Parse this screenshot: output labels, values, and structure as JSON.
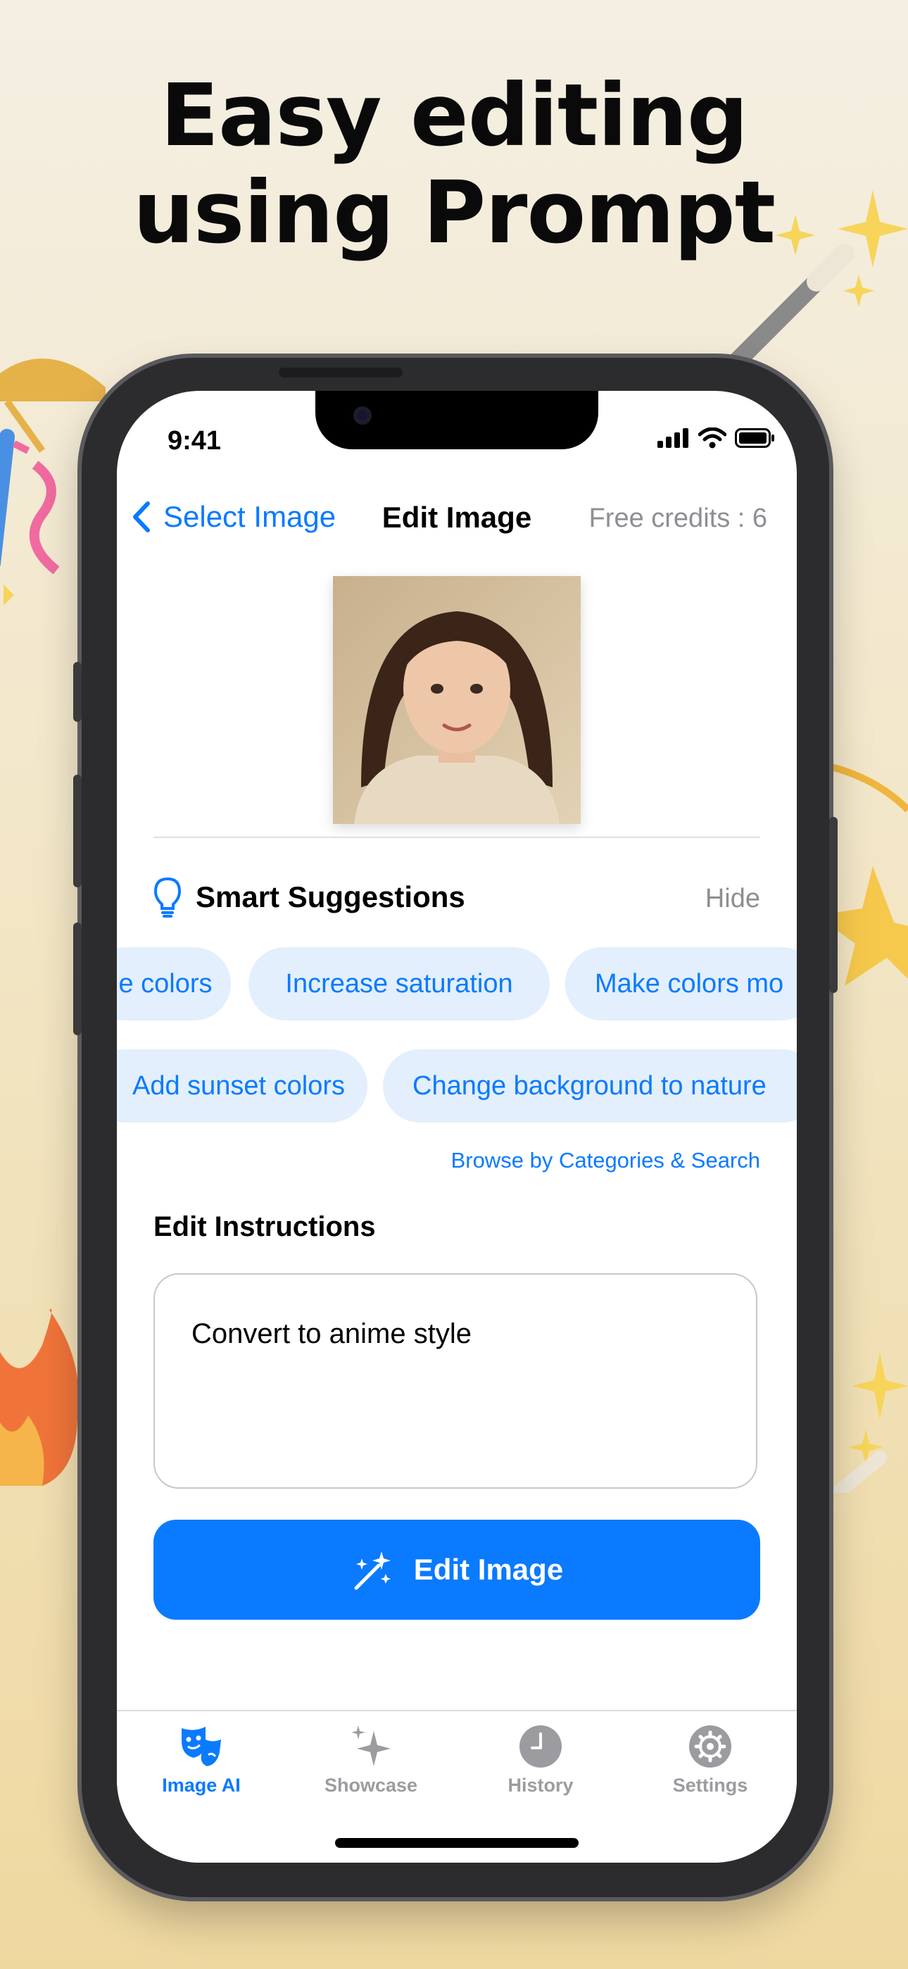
{
  "headline": {
    "line1": "Easy editing",
    "line2": "using Prompt"
  },
  "status_bar": {
    "time": "9:41"
  },
  "nav": {
    "back_label": "Select Image",
    "title": "Edit Image",
    "credits": "Free credits : 6"
  },
  "suggestions": {
    "title": "Smart Suggestions",
    "hide_label": "Hide",
    "row1": [
      "e colors",
      "Increase saturation",
      "Make colors mo"
    ],
    "row2": [
      "Add sunset colors",
      "Change background to nature"
    ],
    "browse_link": "Browse by Categories & Search"
  },
  "edit": {
    "label": "Edit Instructions",
    "instruction_value": "Convert to anime style",
    "button_label": "Edit Image"
  },
  "tabbar": {
    "tabs": [
      {
        "label": "Image AI",
        "icon": "theater-masks-icon",
        "active": true
      },
      {
        "label": "Showcase",
        "icon": "sparkles-icon",
        "active": false
      },
      {
        "label": "History",
        "icon": "clock-icon",
        "active": false
      },
      {
        "label": "Settings",
        "icon": "gear-icon",
        "active": false
      }
    ]
  },
  "colors": {
    "accent": "#0A7AFF",
    "chip_bg": "#E3EFFC",
    "muted": "#8E8E93"
  }
}
